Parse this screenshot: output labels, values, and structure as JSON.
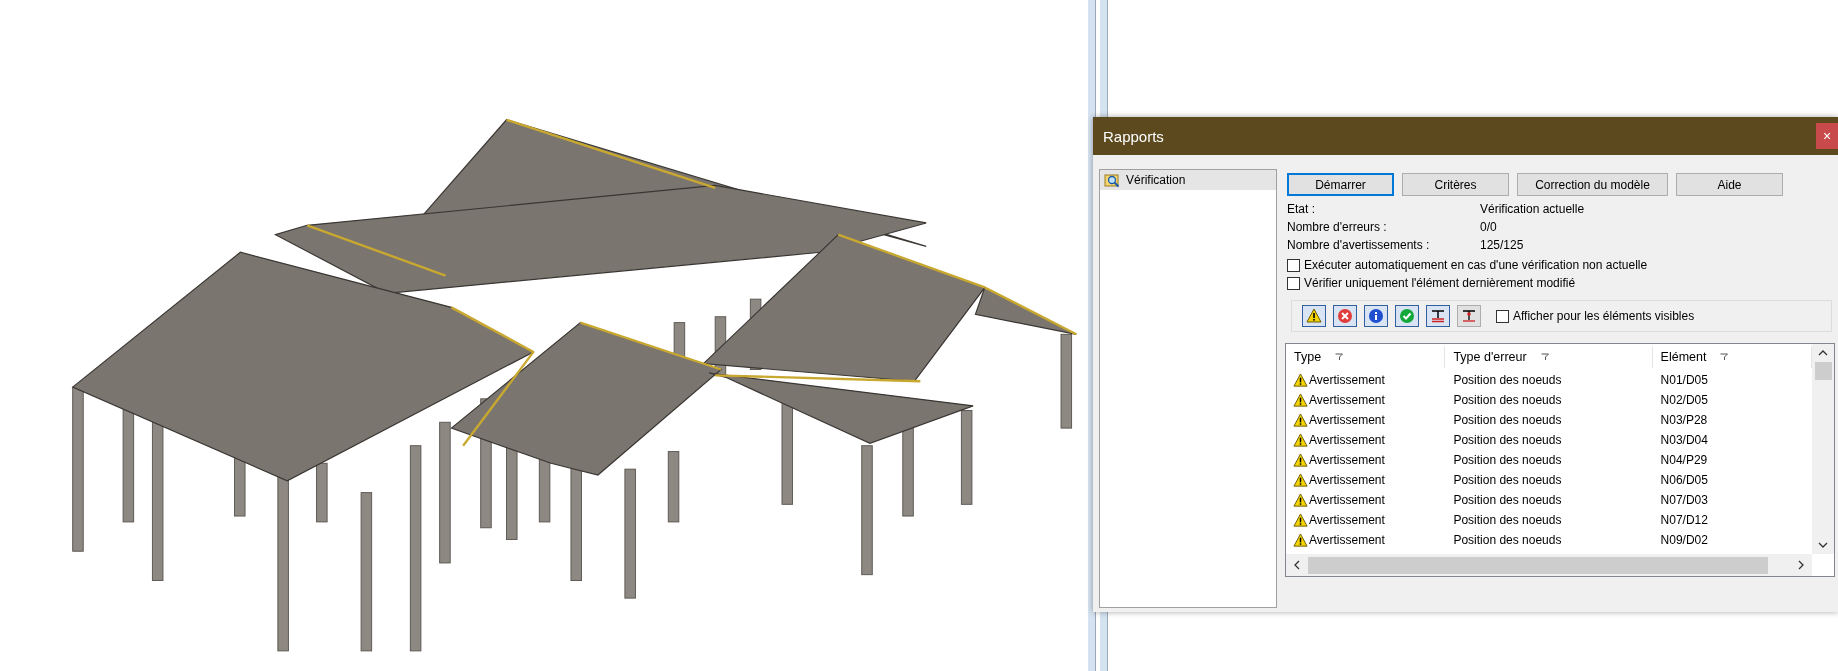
{
  "dialog": {
    "title": "Rapports",
    "close": "×"
  },
  "tree": {
    "items": [
      {
        "label": "Vérification",
        "selected": true
      }
    ]
  },
  "buttons": [
    {
      "label": "Démarrer",
      "default": true
    },
    {
      "label": "Critères",
      "default": false
    },
    {
      "label": "Correction du modèle",
      "default": false
    },
    {
      "label": "Aide",
      "default": false
    }
  ],
  "status": [
    {
      "label": "Etat :",
      "value": "Vérification actuelle"
    },
    {
      "label": "Nombre d'erreurs :",
      "value": "0/0"
    },
    {
      "label": "Nombre d'avertissements :",
      "value": "125/125"
    }
  ],
  "options": [
    {
      "label": "Exécuter automatiquement en cas d'une vérification non actuelle",
      "checked": false
    },
    {
      "label": "Vérifier uniquement l'élément dernièrement modifié",
      "checked": false
    }
  ],
  "filters": {
    "toggles": [
      {
        "kind": "warning",
        "on": true
      },
      {
        "kind": "error",
        "on": true
      },
      {
        "kind": "info",
        "on": true
      },
      {
        "kind": "ok",
        "on": true
      },
      {
        "kind": "bar",
        "on": true
      },
      {
        "kind": "node",
        "on": false
      }
    ],
    "visible_only": {
      "label": "Afficher pour les éléments visibles",
      "checked": false
    }
  },
  "table": {
    "columns": [
      "Type",
      "Type d'erreur",
      "Elément"
    ],
    "rows": [
      {
        "kind": "warning",
        "type": "Avertissement",
        "error_type": "Position des noeuds",
        "element": "N01/D05"
      },
      {
        "kind": "warning",
        "type": "Avertissement",
        "error_type": "Position des noeuds",
        "element": "N02/D05"
      },
      {
        "kind": "warning",
        "type": "Avertissement",
        "error_type": "Position des noeuds",
        "element": "N03/P28"
      },
      {
        "kind": "warning",
        "type": "Avertissement",
        "error_type": "Position des noeuds",
        "element": "N03/D04"
      },
      {
        "kind": "warning",
        "type": "Avertissement",
        "error_type": "Position des noeuds",
        "element": "N04/P29"
      },
      {
        "kind": "warning",
        "type": "Avertissement",
        "error_type": "Position des noeuds",
        "element": "N06/D05"
      },
      {
        "kind": "warning",
        "type": "Avertissement",
        "error_type": "Position des noeuds",
        "element": "N07/D03"
      },
      {
        "kind": "warning",
        "type": "Avertissement",
        "error_type": "Position des noeuds",
        "element": "N07/D12"
      },
      {
        "kind": "warning",
        "type": "Avertissement",
        "error_type": "Position des noeuds",
        "element": "N09/D02"
      }
    ]
  }
}
